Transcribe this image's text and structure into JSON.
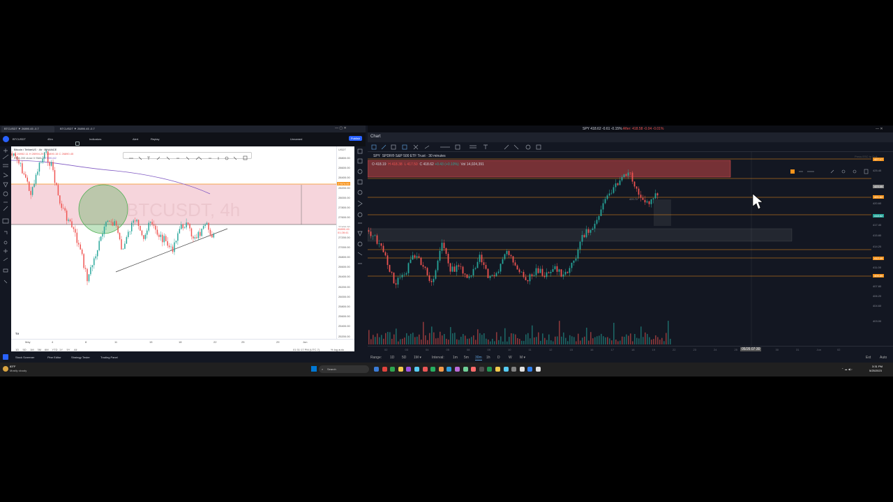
{
  "left": {
    "tabs": [
      {
        "label": "BTCUSDT ▼ 26890.45 -0.7"
      },
      {
        "label": "BTCUSDT ▼ 26890.45 -0.7"
      }
    ],
    "toolbar": {
      "interval": "45m",
      "indicators": "Indicators",
      "alert": "Alert",
      "replay": "Replay",
      "unnamed": "Unnamed",
      "publish": "Publish"
    },
    "symbol_title": "Bitcoin / TetherUS · 4h · BINANCE",
    "ohlc": "O 26952.11 H 26994.29 L 26890.15 C 26890.45",
    "indicator": "EMA 200 close 0 SMA 9",
    "indicator_value": "27891.62",
    "watermark": "BTCUSDT, 4h",
    "price_axis": [
      "28800.00",
      "28600.00",
      "28400.00",
      "28200.00",
      "28000.00",
      "27800.00",
      "27600.00",
      "27400.00",
      "27200.00",
      "27000.00",
      "26800.00",
      "26600.00",
      "26400.00",
      "26200.00",
      "26000.00",
      "25800.00",
      "25600.00",
      "25400.00",
      "25200.00"
    ],
    "axis_currency": "USDT",
    "highlight_price": "27674.00",
    "last_price": "26890.45",
    "last_time": "01:28:41",
    "time_axis": [
      "May",
      "4",
      "8",
      "11",
      "15",
      "18",
      "22",
      "25",
      "29",
      "Jun"
    ],
    "ranges": [
      "1D",
      "5D",
      "1M",
      "3M",
      "6M",
      "YTD",
      "1Y",
      "5Y",
      "All"
    ],
    "clock": "01:31:17 PM (UTC-7)",
    "scale": [
      "%",
      "log",
      "auto"
    ],
    "panels": [
      "Stock Screener",
      "Pine Editor",
      "Strategy Tester",
      "Trading Panel"
    ]
  },
  "right": {
    "window_title": "SPY 418.62 -0.61 -0.15%",
    "after_hours": "After: 418.58 -0.04 -0.01%",
    "tab": "Chart",
    "symbol": "SPY",
    "name": "SPDR® S&P 500 ETF Trust",
    "interval": "30 minutes",
    "ohlc": {
      "o": "O 418.19",
      "h": "H 418.38",
      "l": "L 417.50",
      "c": "C 418.62",
      "chg": "+0.43 (+0.10%)",
      "vol": "Vol 14,024,391"
    },
    "press_esc": "Press ESC to Quit",
    "price_axis": [
      "427.17",
      "425.40",
      "423.05",
      "421.62",
      "420.60",
      "418.62",
      "417.40",
      "415.80",
      "414.20",
      "412.49",
      "411.00",
      "409.89",
      "407.80",
      "406.20",
      "404.60",
      "403.00"
    ],
    "hilite_label": "420.72",
    "hover_time": "05/26 07:30",
    "time_axis": [
      "02",
      "03",
      "04",
      "05",
      "08",
      "09",
      "10",
      "11",
      "12",
      "15",
      "16",
      "17",
      "18",
      "19",
      "22",
      "23",
      "24",
      "25",
      "29",
      "30",
      "31",
      "Jun",
      "02"
    ],
    "range_label": "Range:",
    "ranges": [
      "1D",
      "5D",
      "1M ▾"
    ],
    "interval_label": "Interval:",
    "intervals": [
      "1m",
      "5m",
      "30m",
      "1h",
      "D",
      "W",
      "M ▾"
    ],
    "ext": "Ext",
    "auto": "Auto"
  },
  "taskbar": {
    "weather": "83°F",
    "weather_desc": "Mostly cloudy",
    "search": "Search",
    "time": "3:31 PM",
    "date": "5/25/2023"
  },
  "colors": {
    "up": "#26a69a",
    "down": "#ef5350",
    "orange": "#f7931a",
    "pink_zone": "#f6d5dc",
    "dark_bg": "#131722"
  }
}
